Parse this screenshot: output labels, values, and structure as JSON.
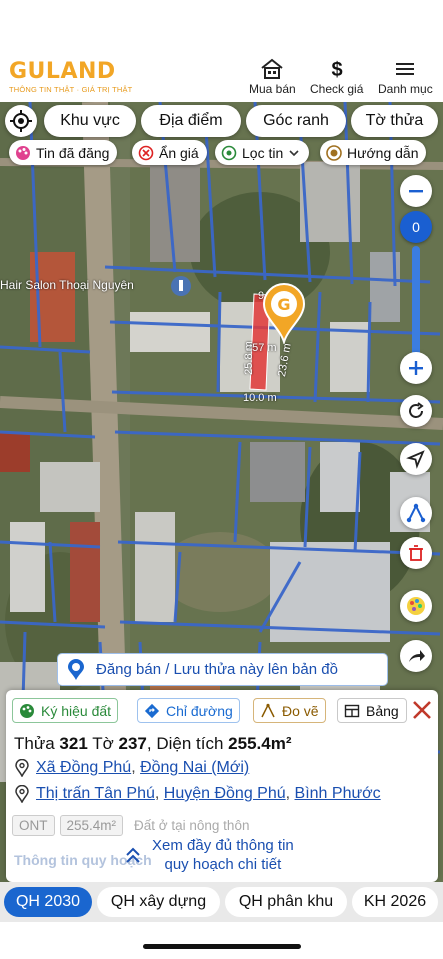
{
  "header": {
    "logo_text": "GULAND",
    "logo_tagline": "THÔNG TIN THẬT · GIÁ TRỊ THẬT",
    "nav": [
      {
        "label": "Mua bán",
        "icon": "house-icon"
      },
      {
        "label": "Check giá",
        "icon": "dollar-icon"
      },
      {
        "label": "Danh mục",
        "icon": "menu-icon"
      }
    ]
  },
  "map": {
    "filter_chips": [
      "Khu vực",
      "Địa điểm",
      "Góc ranh",
      "Tờ thửa"
    ],
    "toggle_chips": [
      {
        "label": "Tin đã đăng",
        "icon": "palette-icon"
      },
      {
        "label": "Ẩn giá",
        "icon": "hide-price-icon"
      },
      {
        "label": "Lọc tin",
        "icon": "location-filter-icon"
      },
      {
        "label": "Hướng dẫn",
        "icon": "guide-icon"
      }
    ],
    "zoom_value": "0",
    "place_label": "Hair Salon Thoại Nguyên",
    "parcel_labels": {
      "area": "257 m",
      "left": "25.8 m",
      "right": "23.6 m",
      "bottom": "10.0 m",
      "top": "9"
    },
    "post_banner": "Đăng bán / Lưu thửa này lên bản đồ"
  },
  "panel": {
    "tabs": [
      {
        "label": "Ký hiệu đất",
        "icon": "palette-icon"
      },
      {
        "label": "Chỉ đường",
        "icon": "directions-icon"
      },
      {
        "label": "Đo vẽ",
        "icon": "measure-icon"
      },
      {
        "label": "Bảng",
        "icon": "table-icon"
      }
    ],
    "title": {
      "thua_label": "Thửa",
      "thua_value": "321",
      "to_label": "Tờ",
      "to_value": "237",
      "area_label": "Diện tích",
      "area_value": "255.4m²"
    },
    "address_new": {
      "ward": "Xã Đồng Phú",
      "province": "Đồng Nai (Mới)"
    },
    "address_old": {
      "town": "Thị trấn Tân Phú",
      "district": "Huyện Đồng Phú",
      "province": "Bình Phước"
    },
    "zone": {
      "code": "ONT",
      "area": "255.4m²",
      "description": "Đất ở tại nông thôn"
    },
    "faded_heading": "Thông tin quy hoạch",
    "more_line1": "Xem đầy đủ thông tin",
    "more_line2": "quy hoạch chi tiết"
  },
  "bottom_tabs": [
    {
      "label": "QH 2030",
      "active": true
    },
    {
      "label": "QH xây dựng",
      "active": false
    },
    {
      "label": "QH phân khu",
      "active": false
    },
    {
      "label": "KH 2026",
      "active": false
    }
  ],
  "colors": {
    "brand": "#f2a626",
    "link": "#1a4fb0",
    "primary": "#1a66cf",
    "parcel_highlight": "#e23a3a"
  }
}
